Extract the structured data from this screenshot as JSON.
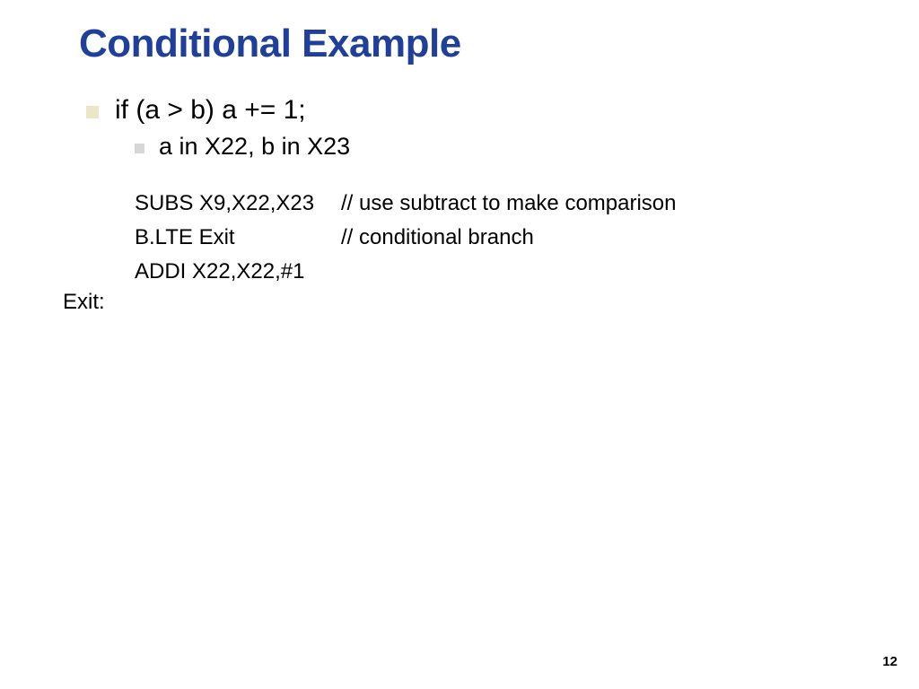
{
  "title": "Conditional Example",
  "bullet1": "if (a > b) a += 1;",
  "bullet2": "a in X22, b in X23",
  "code": {
    "row1": {
      "left": "SUBS X9,X22,X23",
      "right": "// use subtract to make comparison"
    },
    "row2": {
      "left": "B.LTE Exit",
      "right": "// conditional branch"
    },
    "row3": {
      "left": "ADDI X22,X22,#1",
      "right": ""
    }
  },
  "exit_label": "Exit:",
  "page_number": "12"
}
